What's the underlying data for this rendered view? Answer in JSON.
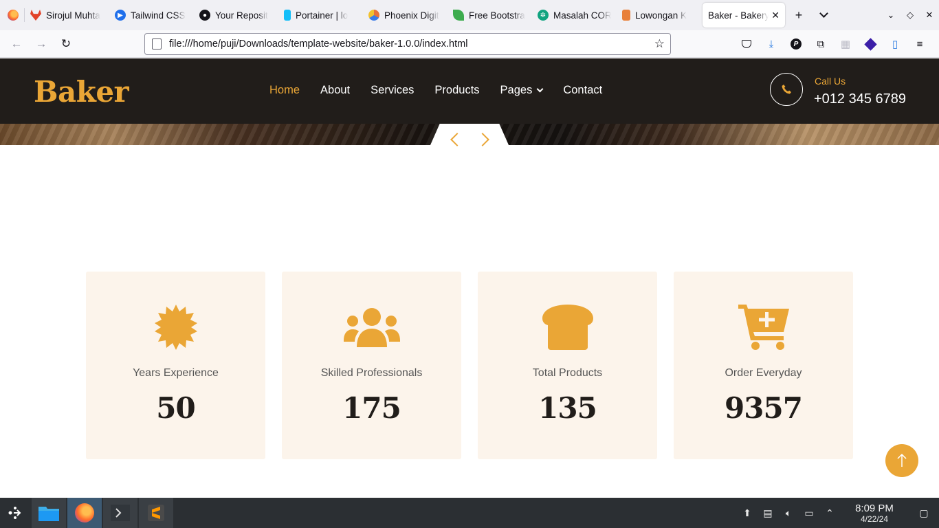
{
  "browser": {
    "tabs": [
      {
        "title": "Sirojul Muhta",
        "icon": "gitlab-icon",
        "color": "#e24329"
      },
      {
        "title": "Tailwind CSS",
        "icon": "play-icon",
        "color": "#1f6feb"
      },
      {
        "title": "Your Reposit",
        "icon": "github-icon",
        "color": "#15141a"
      },
      {
        "title": "Portainer | lo",
        "icon": "portainer-icon",
        "color": "#13bef9"
      },
      {
        "title": "Phoenix Digit",
        "icon": "phoenix-icon",
        "color": "#e8723a"
      },
      {
        "title": "Free Bootstra",
        "icon": "bootstrap-leaf-icon",
        "color": "#3dac4e"
      },
      {
        "title": "Masalah COR",
        "icon": "chatgpt-icon",
        "color": "#10a37f"
      },
      {
        "title": "Lowongan K",
        "icon": "job-icon",
        "color": "#e8803a"
      },
      {
        "title": "Baker - Bakery",
        "icon": "bakery-icon",
        "color": "#eaa636"
      }
    ],
    "url": "file:///home/puji/Downloads/template-website/baker-1.0.0/index.html"
  },
  "site": {
    "brand": "Baker",
    "menu": {
      "home": "Home",
      "about": "About",
      "services": "Services",
      "products": "Products",
      "pages": "Pages",
      "contact": "Contact"
    },
    "call": {
      "label": "Call Us",
      "number": "+012 345 6789"
    },
    "accent": "#eaa636",
    "dark": "#211d1a"
  },
  "facts": [
    {
      "label": "Years Experience",
      "value": "50",
      "icon": "certificate-icon"
    },
    {
      "label": "Skilled Professionals",
      "value": "175",
      "icon": "users-icon"
    },
    {
      "label": "Total Products",
      "value": "135",
      "icon": "bread-icon"
    },
    {
      "label": "Order Everyday",
      "value": "9357",
      "icon": "cart-plus-icon"
    }
  ],
  "taskbar": {
    "time": "8:09 PM",
    "date": "4/22/24"
  }
}
